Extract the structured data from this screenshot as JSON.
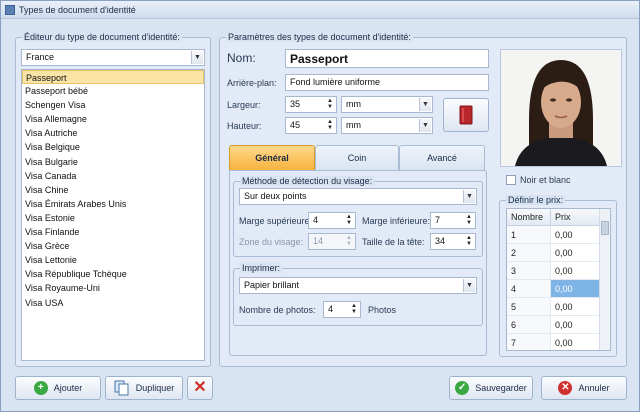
{
  "window": {
    "title": "Types de document d'identité"
  },
  "editor": {
    "legend": "Éditeur du type de document d'identité:",
    "country": "France",
    "items": [
      "Passeport",
      "Passeport bébé",
      "Schengen Visa",
      "Visa Allemagne",
      "Visa Autriche",
      "Visa Belgique",
      "Visa Bulgarie",
      "Visa Canada",
      "Visa Chine",
      "Visa Émirats Arabes Unis",
      "Visa Estonie",
      "Visa Finlande",
      "Visa Grèce",
      "Visa Lettonie",
      "Visa République Tchèque",
      "Visa Royaume-Uni",
      "Visa USA"
    ]
  },
  "params": {
    "legend": "Paramètres des types de document d'identité:",
    "name_label": "Nom:",
    "name_value": "Passeport",
    "bg_label": "Arrière-plan:",
    "bg_value": "Fond lumière uniforme",
    "width_label": "Largeur:",
    "width_value": "35",
    "width_unit": "mm",
    "height_label": "Hauteur:",
    "height_value": "45",
    "height_unit": "mm"
  },
  "tabs": [
    "Général",
    "Coin",
    "Avancé"
  ],
  "detection": {
    "legend": "Méthode de détection du visage:",
    "method": "Sur deux points",
    "top_margin_label": "Marge supérieure:",
    "top_margin_value": "4",
    "bottom_margin_label": "Marge inférieure:",
    "bottom_margin_value": "7",
    "face_zone_label": "Zone du visage:",
    "face_zone_value": "14",
    "head_size_label": "Taille de la tête:",
    "head_size_value": "34"
  },
  "print": {
    "legend": "Imprimer:",
    "paper": "Papier brillant",
    "count_label": "Nombre de photos:",
    "count_value": "4",
    "count_unit": "Photos"
  },
  "right": {
    "bw_label": "Noir et blanc",
    "price_legend": "Définir le prix:",
    "grid_headers": [
      "Nombre",
      "Prix"
    ],
    "rows": [
      [
        "1",
        "0,00"
      ],
      [
        "2",
        "0,00"
      ],
      [
        "3",
        "0,00"
      ],
      [
        "4",
        "0,00"
      ],
      [
        "5",
        "0,00"
      ],
      [
        "6",
        "0,00"
      ],
      [
        "7",
        "0,00"
      ]
    ]
  },
  "buttons": {
    "add": "Ajouter",
    "duplicate": "Dupliquer",
    "save": "Sauvegarder",
    "cancel": "Annuler"
  }
}
